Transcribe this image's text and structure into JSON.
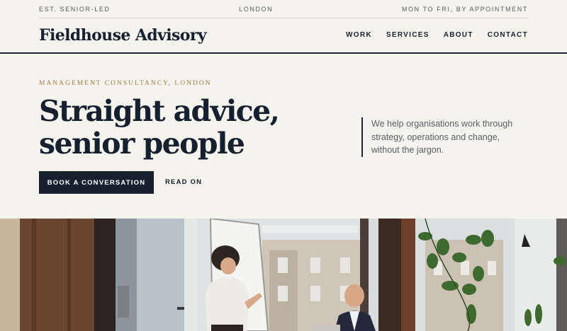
{
  "topbar": {
    "left": "EST. SENIOR-LED",
    "center": "LONDON",
    "right": "MON TO FRI, BY APPOINTMENT"
  },
  "header": {
    "logo": "Fieldhouse Advisory",
    "nav": [
      "WORK",
      "SERVICES",
      "ABOUT",
      "CONTACT"
    ]
  },
  "intro": {
    "eyebrow": "MANAGEMENT CONSULTANCY, LONDON",
    "headline": "Straight advice, senior people",
    "blurb": "We help organisations work through strategy, operations and change, without the jargon.",
    "primary_cta": "BOOK A CONVERSATION",
    "secondary_cta": "READ ON"
  },
  "colors": {
    "background": "#f5f3ee",
    "ink": "#17202e",
    "accent": "#a77b40"
  }
}
